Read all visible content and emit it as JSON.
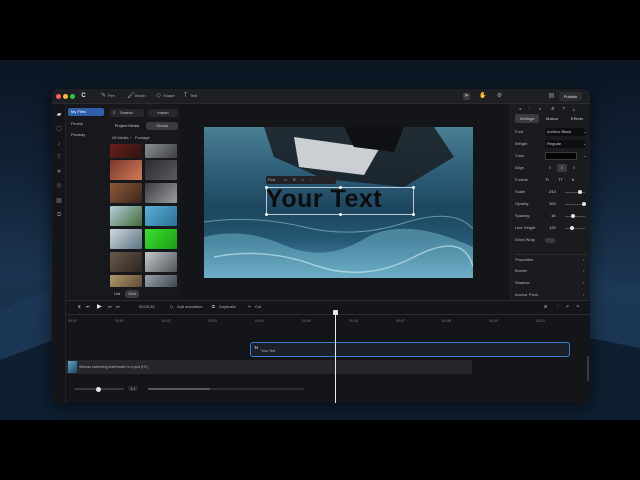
{
  "toolbar": {
    "tools": [
      "Pen",
      "Brush",
      "Shape",
      "Text"
    ],
    "publish_label": "Publish"
  },
  "sidebar": {
    "items": [
      {
        "label": "My Files",
        "active": true
      },
      {
        "label": "Pexels"
      },
      {
        "label": "Pixabay"
      }
    ]
  },
  "media": {
    "search_label": "Search",
    "import_label": "Import",
    "tabs": [
      "Project Media",
      "Global"
    ],
    "breadcrumb": [
      "All Media",
      "Footage"
    ],
    "view_toggle": [
      "List",
      "Grid"
    ]
  },
  "canvas": {
    "overlay_text": "Your Text",
    "float_toolbar_label": "Font"
  },
  "panel": {
    "tabs": [
      "Settings",
      "Motion",
      "Effects"
    ],
    "font_label": "Font",
    "font_value": "Archivo Black",
    "weight_label": "Weight",
    "weight_value": "Regular",
    "color_label": "Color",
    "align_label": "Align",
    "format_label": "Format",
    "format_options": [
      "Tt",
      "TT",
      "tt"
    ],
    "scale_label": "Scale",
    "scale_value": "243",
    "opacity_label": "Opacity",
    "opacity_value": "100",
    "spacing_label": "Spacing",
    "spacing_value": "16",
    "line_height_label": "Line Height",
    "line_height_value": "120",
    "wordwrap_label": "Word Wrap",
    "sections": [
      "Properties",
      "Border",
      "Shadow",
      "Anchor Point"
    ]
  },
  "timeline": {
    "time": "00:03.32",
    "actions": [
      "Add animation",
      "Duplicate",
      "Cut"
    ],
    "ticks": [
      "00:00",
      "00:01",
      "00:02",
      "00:03",
      "00:04",
      "00:05",
      "00:06",
      "00:07",
      "00:08",
      "00:09",
      "00:10"
    ],
    "text_clip": {
      "icon": "Tt",
      "label": "Your Text"
    },
    "video_clip_label": "Woman swimming underwater in a pool (HT)",
    "zoom_value": "1:1"
  },
  "colors": {
    "accent": "#3b7bd6",
    "publish_bg": "#2c2d31"
  }
}
